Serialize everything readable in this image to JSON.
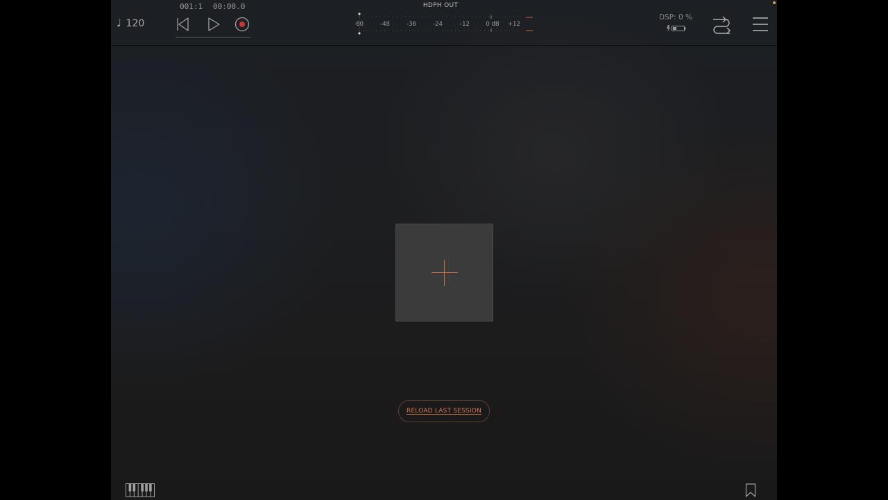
{
  "topbar": {
    "tempo": {
      "note_glyph": "♩",
      "bpm": "120"
    },
    "position": {
      "bars": "001:1",
      "time": "00:00.0"
    },
    "transport": {
      "icons": [
        "rewind-icon",
        "play-icon",
        "record-icon"
      ],
      "record_color": "#d0342c"
    },
    "meter": {
      "title": "HDPH OUT",
      "scale_labels": [
        "-60",
        "-48",
        "-36",
        "-24",
        "-12",
        "0 dB",
        "+12"
      ],
      "clip_color": "#c86a3c"
    },
    "dsp": {
      "label": "DSP: 0 %"
    },
    "icons": [
      "battery-icon",
      "routing-icon",
      "menu-icon"
    ]
  },
  "main": {
    "add_tile": {
      "icon": "plus-icon",
      "accent": "#cc6a3c"
    },
    "reload_button": {
      "label": "RELOAD LAST SESSION"
    }
  },
  "bottombar": {
    "icons": [
      "keyboard-icon",
      "bookmark-icon"
    ]
  },
  "colors": {
    "accent_orange": "#cc6a3c",
    "record_red": "#d0342c",
    "background": "#1d1e20"
  }
}
